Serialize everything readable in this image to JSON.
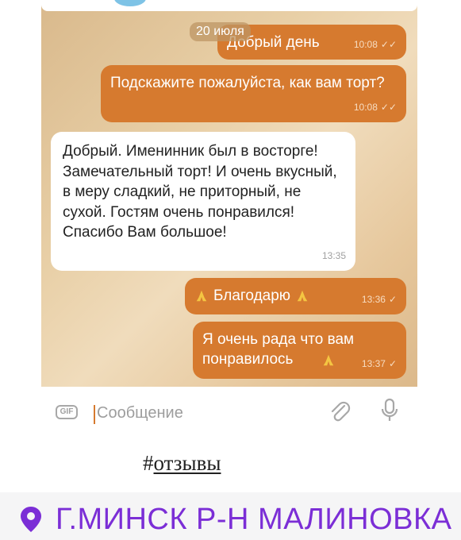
{
  "chat": {
    "date_badge": "20 июля",
    "messages": [
      {
        "direction": "out",
        "text": "Добрый день",
        "time": "10:08"
      },
      {
        "direction": "out",
        "text": "Подскажите пожалуйста, как вам торт?",
        "time": "10:08"
      },
      {
        "direction": "in",
        "text": "Добрый. Именинник был в восторге! Замечательный торт! И очень вкусный, в меру сладкий, не приторный, не сухой. Гостям очень понравился! Спасибо Вам большое!",
        "time": "13:35"
      },
      {
        "direction": "out",
        "text": "Благодарю",
        "time": "13:36"
      },
      {
        "direction": "out",
        "text": "Я очень рада что вам понравилось",
        "time": "13:37"
      }
    ]
  },
  "input_bar": {
    "gif_label": "GIF",
    "placeholder": "Сообщение",
    "attach_icon": "paperclip-icon",
    "mic_icon": "microphone-icon"
  },
  "hashtag": {
    "symbol": "#",
    "text": "отзывы"
  },
  "location": {
    "text": "Г.МИНСК Р-Н МАЛИНОВКА",
    "icon": "map-pin-icon",
    "color": "#7b2ed6"
  },
  "colors": {
    "outgoing_bubble": "#d67a2f",
    "incoming_bubble": "#ffffff",
    "accent": "#d67a2f"
  }
}
